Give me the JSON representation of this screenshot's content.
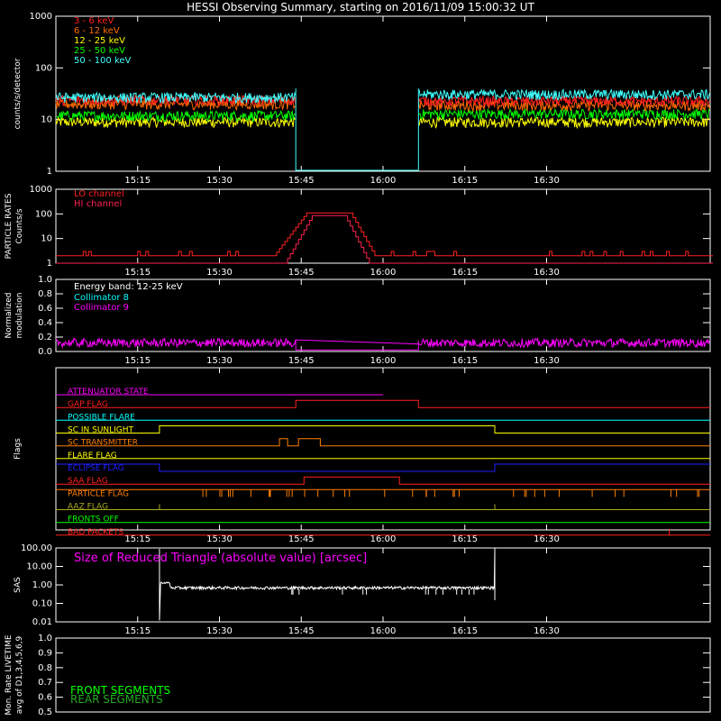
{
  "title": "HESSI Observing Summary, starting on 2016/11/09 15:00:32 UT",
  "colors": {
    "bg": "#000000",
    "axis": "#ffffff",
    "band_3_6": "#ff2020",
    "band_6_12": "#ff6a00",
    "band_12_25": "#ffff00",
    "band_25_50": "#00ff00",
    "band_50_100": "#40ffff",
    "magenta": "#ff00ff",
    "cyan": "#00ffff",
    "green": "#00ff00",
    "darkgreen": "#22aa22",
    "red": "#ff2020",
    "orange": "#ff7f00",
    "yellow": "#ffff00",
    "blue": "#2020ff",
    "olive": "#aaaa22",
    "crimson": "#ff2050"
  },
  "time_axis": {
    "x_range_minutes": [
      0,
      60
    ],
    "tick_minutes": [
      15,
      30,
      45,
      60,
      75,
      90
    ],
    "tick_labels": [
      "15:15",
      "15:30",
      "15:45",
      "16:00",
      "16:15",
      "16:30"
    ]
  },
  "chart_data": [
    {
      "id": "count-rates",
      "type": "line",
      "ylabel": "counts/s/detector",
      "yscale": "log",
      "ylim": [
        1,
        1000
      ],
      "ytick_labels": [
        "1",
        "10",
        "100",
        "1000"
      ],
      "gap_minutes": [
        44,
        66.5
      ],
      "series": [
        {
          "name": "3 - 6 keV",
          "color": "#ff2020",
          "level_before": 24,
          "level_after": 23
        },
        {
          "name": "6 - 12 keV",
          "color": "#ff6a00",
          "level_before": 20,
          "level_after": 19
        },
        {
          "name": "12 - 25 keV",
          "color": "#ffff00",
          "level_before": 9,
          "level_after": 9
        },
        {
          "name": "25 - 50 keV",
          "color": "#00ff00",
          "level_before": 12,
          "level_after": 13
        },
        {
          "name": "50 - 100 keV",
          "color": "#40ffff",
          "level_before": 27,
          "level_after": 31
        }
      ]
    },
    {
      "id": "particle-rates",
      "type": "line",
      "ylabel": "PARTICLE RATES",
      "ylabel2": "Counts/s",
      "yscale": "log",
      "ylim": [
        1,
        1000
      ],
      "ytick_labels": [
        "1",
        "10",
        "100",
        "1000"
      ],
      "series": [
        {
          "name": "LO channel",
          "color": "#ff2020",
          "baseline": 2,
          "peak": 110,
          "rise": [
            40,
            46
          ],
          "fall": [
            54,
            58.5
          ]
        },
        {
          "name": "HI channel",
          "color": "#ff2050",
          "baseline": 1,
          "peak": 85,
          "rise": [
            42,
            47
          ],
          "fall": [
            53,
            57.5
          ]
        }
      ]
    },
    {
      "id": "modulation",
      "type": "line",
      "ylabel": "Normalized",
      "ylabel2": "modulation",
      "ylim": [
        0,
        1
      ],
      "ytick_labels": [
        "0.0",
        "0.2",
        "0.4",
        "0.6",
        "0.8",
        "1.0"
      ],
      "annotation": "Energy band: 12-25 keV",
      "gap_minutes": [
        44,
        66.5
      ],
      "series": [
        {
          "name": "Collimator 8",
          "color": "#00ffff",
          "level": 0.1
        },
        {
          "name": "Collimator 9",
          "color": "#ff00ff",
          "level": 0.12
        }
      ]
    },
    {
      "id": "flags",
      "type": "line",
      "ylabel": "Flags",
      "series": [
        {
          "name": "ATTENUATOR STATE",
          "color": "#ff00ff",
          "segments": [
            [
              0,
              60,
              0
            ]
          ]
        },
        {
          "name": "GAP FLAG",
          "color": "#ff2020",
          "segments": [
            [
              0,
              44,
              0
            ],
            [
              44,
              66.5,
              1
            ],
            [
              66.5,
              120,
              0
            ]
          ]
        },
        {
          "name": "POSSIBLE FLARE",
          "color": "#00ffff",
          "segments": [
            [
              0,
              120,
              0
            ]
          ]
        },
        {
          "name": "SC IN SUNLIGHT",
          "color": "#ffff00",
          "segments": [
            [
              0,
              19,
              0
            ],
            [
              19,
              80.5,
              1
            ],
            [
              80.5,
              120,
              0
            ]
          ]
        },
        {
          "name": "SC TRANSMITTER",
          "color": "#ff7f00",
          "segments": [
            [
              0,
              41,
              0
            ],
            [
              41,
              42.5,
              1
            ],
            [
              42.5,
              44.5,
              0
            ],
            [
              44.5,
              48.5,
              1
            ],
            [
              48.5,
              120,
              0
            ]
          ]
        },
        {
          "name": "FLARE FLAG",
          "color": "#ffff00",
          "segments": [
            [
              0,
              120,
              0
            ]
          ]
        },
        {
          "name": "ECLIPSE FLAG",
          "color": "#2020ff",
          "segments": [
            [
              0,
              19,
              1
            ],
            [
              19,
              80.5,
              0
            ],
            [
              80.5,
              120,
              1
            ]
          ]
        },
        {
          "name": "SAA FLAG",
          "color": "#ff2020",
          "segments": [
            [
              0,
              45.5,
              0
            ],
            [
              45.5,
              63,
              1
            ],
            [
              63,
              120,
              0
            ]
          ]
        },
        {
          "name": "PARTICLE FLAG",
          "color": "#ff7f00",
          "segments": [
            [
              0,
              120,
              1
            ]
          ]
        },
        {
          "name": "AAZ FLAG",
          "color": "#aaaa22",
          "segments": [
            [
              0,
              120,
              0
            ]
          ]
        },
        {
          "name": "FRONTS OFF",
          "color": "#00ff00",
          "segments": [
            [
              0,
              120,
              0
            ]
          ]
        },
        {
          "name": "BAD PACKETS",
          "color": "#ff2020",
          "segments": [
            [
              0,
              120,
              0
            ]
          ]
        }
      ]
    },
    {
      "id": "sas",
      "type": "line",
      "ylabel": "SAS",
      "yscale": "log",
      "ylim": [
        0.01,
        100
      ],
      "ytick_labels": [
        "0.01",
        "0.10",
        "1.00",
        "10.00",
        "100.00"
      ],
      "annotation": "Size of Reduced Triangle (absolute value) [arcsec]",
      "series": [
        {
          "name": "Size of Reduced Triangle",
          "color": "#ffffff",
          "start": 19,
          "end": 80.5,
          "level": 0.7
        }
      ]
    },
    {
      "id": "livetime",
      "type": "line",
      "ylabel": "Mon. Rate LIVETIME",
      "ylabel2": "avg of D1,3,4,5,6,9",
      "ylim": [
        0.5,
        1.0
      ],
      "ytick_labels": [
        "0.5",
        "0.6",
        "0.7",
        "0.8",
        "0.9",
        "1.0"
      ],
      "series": [
        {
          "name": "FRONT SEGMENTS",
          "color": "#00ff00"
        },
        {
          "name": "REAR SEGMENTS",
          "color": "#22aa22"
        }
      ]
    }
  ]
}
